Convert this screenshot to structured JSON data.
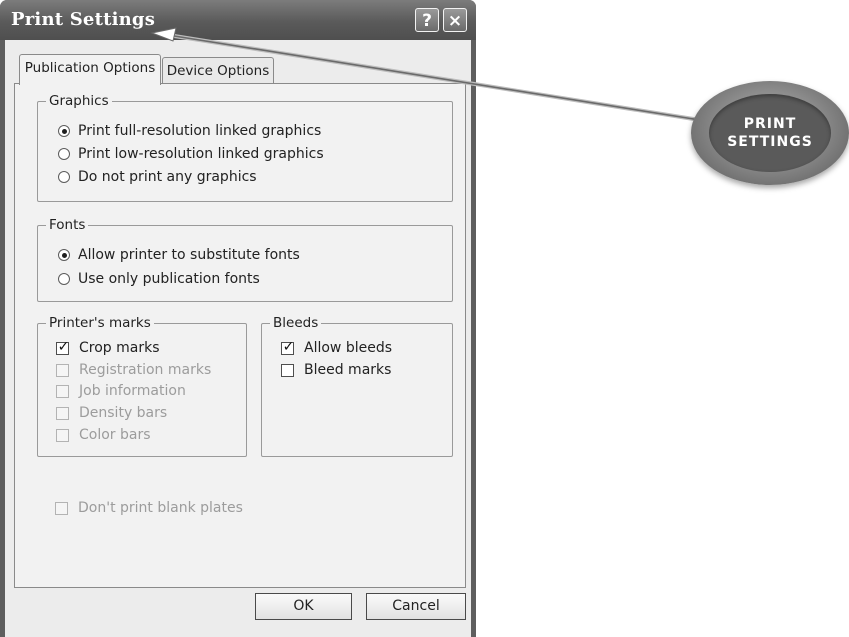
{
  "window": {
    "title": "Print Settings",
    "help_label": "?",
    "close_label": "×"
  },
  "tabs": [
    {
      "label": "Publication Options",
      "active": true
    },
    {
      "label": "Device Options",
      "active": false
    }
  ],
  "graphics": {
    "legend": "Graphics",
    "options": [
      {
        "label": "Print full-resolution linked graphics",
        "selected": true
      },
      {
        "label": "Print low-resolution linked graphics",
        "selected": false
      },
      {
        "label": "Do not print any graphics",
        "selected": false
      }
    ]
  },
  "fonts": {
    "legend": "Fonts",
    "options": [
      {
        "label": "Allow printer to substitute fonts",
        "selected": true
      },
      {
        "label": "Use only publication fonts",
        "selected": false
      }
    ]
  },
  "printers_marks": {
    "legend": "Printer's marks",
    "items": [
      {
        "label": "Crop marks",
        "checked": true,
        "enabled": true
      },
      {
        "label": "Registration marks",
        "checked": false,
        "enabled": false
      },
      {
        "label": "Job information",
        "checked": false,
        "enabled": false
      },
      {
        "label": "Density bars",
        "checked": false,
        "enabled": false
      },
      {
        "label": "Color bars",
        "checked": false,
        "enabled": false
      }
    ]
  },
  "bleeds": {
    "legend": "Bleeds",
    "items": [
      {
        "label": "Allow bleeds",
        "checked": true,
        "enabled": true
      },
      {
        "label": "Bleed marks",
        "checked": false,
        "enabled": true
      }
    ]
  },
  "blank_plates": {
    "label": "Don't print blank plates",
    "checked": false,
    "enabled": false
  },
  "buttons": {
    "ok": "OK",
    "cancel": "Cancel"
  },
  "callout": {
    "line1": "PRINT",
    "line2": "SETTINGS"
  }
}
